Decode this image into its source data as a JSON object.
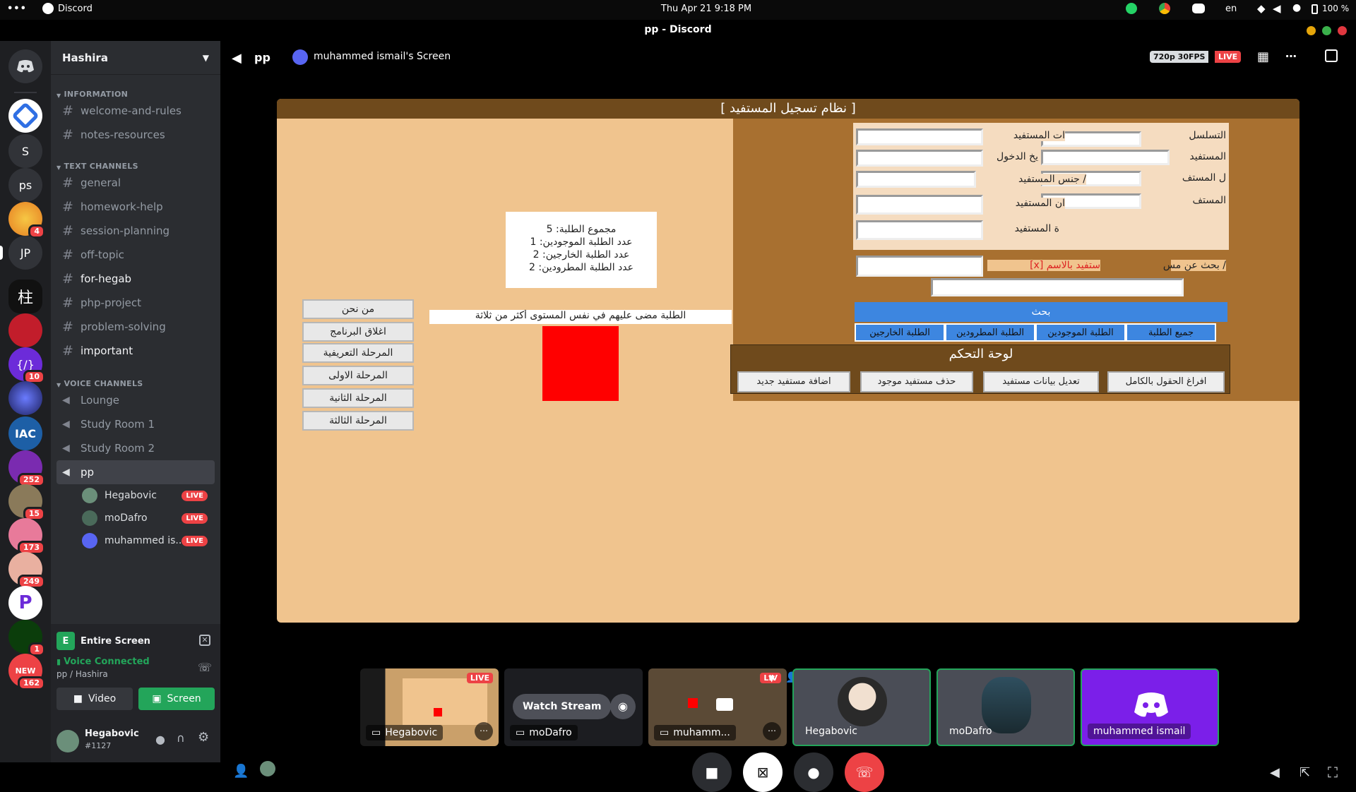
{
  "topbar": {
    "dots": "•••",
    "app": "Discord",
    "datetime": "Thu Apr 21   9:18 PM",
    "lang": "en",
    "battery": "100 %"
  },
  "titlebar": {
    "title": "pp - Discord"
  },
  "guilds": [
    {
      "label": "S",
      "badge": ""
    },
    {
      "label": "ps",
      "badge": ""
    },
    {
      "label": "",
      "badge": "4"
    },
    {
      "label": "JP",
      "badge": ""
    },
    {
      "label": "",
      "badge": ""
    },
    {
      "label": "",
      "badge": ""
    },
    {
      "label": "{/}",
      "badge": "10"
    },
    {
      "label": "",
      "badge": ""
    },
    {
      "label": "IAC",
      "badge": ""
    },
    {
      "label": "",
      "badge": "252"
    },
    {
      "label": "",
      "badge": "15"
    },
    {
      "label": "",
      "badge": "173"
    },
    {
      "label": "",
      "badge": "249"
    },
    {
      "label": "P",
      "badge": ""
    },
    {
      "label": "",
      "badge": "1"
    },
    {
      "label": "NEW",
      "badge": "162"
    }
  ],
  "server": {
    "name": "Hashira"
  },
  "categories": {
    "info": "INFORMATION",
    "text": "TEXT CHANNELS",
    "voice": "VOICE CHANNELS"
  },
  "info_channels": [
    "welcome-and-rules",
    "notes-resources"
  ],
  "text_channels": [
    "general",
    "homework-help",
    "session-planning",
    "off-topic",
    "for-hegab",
    "php-project",
    "problem-solving",
    "important"
  ],
  "voice_channels": [
    "Lounge",
    "Study Room 1",
    "Study Room 2",
    "pp"
  ],
  "voice_users": [
    {
      "name": "Hegabovic",
      "live": "LIVE"
    },
    {
      "name": "moDafro",
      "live": "LIVE"
    },
    {
      "name": "muhammed is...",
      "live": "LIVE"
    }
  ],
  "panel": {
    "entire_screen": "Entire Screen",
    "voice_connected": "Voice Connected",
    "voice_sub": "pp / Hashira",
    "video": "Video",
    "screen": "Screen"
  },
  "user": {
    "name": "Hegabovic",
    "tag": "#1127"
  },
  "stream": {
    "channel": "pp",
    "screen_owner": "muhammed ismail's Screen",
    "quality": "720p 30FPS",
    "live": "LIVE"
  },
  "app": {
    "title": "[      نظام تسجيل المستفيد      ]",
    "stats": [
      "مجموع الطلبة: 5",
      "عدد الطلبة الموجودين: 1",
      "عدد الطلبة الخارجين: 2",
      "عدد الطلبة المطرودين: 2"
    ],
    "warning": "الطلبة مضى عليهم في نفس المستوى أكثر من ثلاثة",
    "left_buttons": [
      "من نحن",
      "اغلاق البرنامج",
      "المرحلة التعريفية",
      "المرحلة الاولى",
      "المرحلة الثانية",
      "المرحلة الثالثة"
    ],
    "form_labels": [
      "ات المستفيد",
      "يخ الدخول",
      "/ جنس المستفيد",
      "ان المستفيد",
      "ة المستفيد",
      "ستفيد بالاسم [x]"
    ],
    "right_labels": [
      "التسلسل",
      "المستفيد",
      "ل المستف",
      "المستف",
      "/ بحث عن مس"
    ],
    "search": "بحث",
    "tabs": [
      "الطلبة الخارجين",
      "الطلبة المطرودين",
      "الطلبة الموجودين",
      "جميع الطلبة"
    ],
    "control_title": "لوحة التحكم",
    "control_buttons": [
      "اضافة مستفيد جديد",
      "حذف مستفيد موجود",
      "تعديل بيانات مستفيد",
      "افراغ الحقول بالكامل"
    ]
  },
  "tiles": {
    "t1": "Hegabovic",
    "t1_live": "LIVE",
    "t2": "moDafro",
    "t2_watch": "Watch Stream",
    "t3": "muhamm...",
    "t3_live": "LIV",
    "p1": "Hegabovic",
    "p2": "moDafro",
    "p3": "muhammed ismail"
  },
  "colors": {
    "accent": "#5865f2",
    "live": "#ed4245",
    "green": "#23a55a"
  }
}
